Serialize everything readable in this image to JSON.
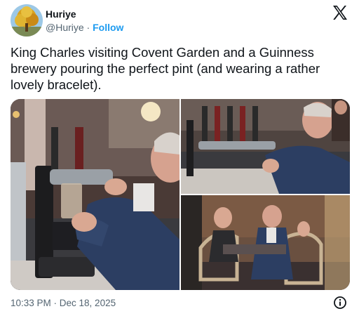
{
  "author": {
    "name": "Huriye",
    "handle": "@Huriye",
    "separator": " · ",
    "follow_label": "Follow",
    "avatar_icon": "autumn-tree-avatar"
  },
  "tweet": {
    "text": "King Charles visiting Covent Garden and a Guinness brewery pouring the perfect pint (and wearing a rather lovely bracelet)."
  },
  "media": {
    "photos": [
      {
        "subject": "man pouring pint at bar tap"
      },
      {
        "subject": "man pouring pint at row of taps"
      },
      {
        "subject": "man and bartenders behind bar with harp taps"
      }
    ]
  },
  "footer": {
    "timestamp": "10:33 PM · Dec 18, 2025",
    "info_icon": "info-icon"
  },
  "icons": {
    "platform_logo": "x-logo-icon"
  },
  "colors": {
    "text": "#0f1419",
    "secondary": "#536471",
    "accent": "#1d9bf0"
  }
}
